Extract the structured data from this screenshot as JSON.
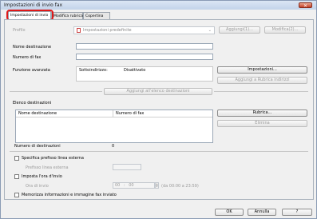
{
  "window": {
    "title": "Impostazioni di invio fax",
    "close_glyph": "✕"
  },
  "tabs": [
    {
      "label": "Impostazioni di invio"
    },
    {
      "label": "Modifica rubrica"
    },
    {
      "label": "Copertina"
    }
  ],
  "profile": {
    "label": "Profilo",
    "value": "Impostazioni predefinite",
    "add_button": "Aggiungi(1)...",
    "edit_button": "Modifica(2)..."
  },
  "destination_name": {
    "label": "Nome destinazione",
    "value": ""
  },
  "fax_number": {
    "label": "Numero di fax",
    "value": ""
  },
  "advanced": {
    "label": "Funzione avanzata",
    "subaddress_label": "Sottoindirizzo:",
    "subaddress_value": "Disattivato",
    "settings_button": "Impostazioni...",
    "add_to_book_button": "Aggiungi a Rubrica indirizzi"
  },
  "add_to_list_button": "Aggiungi all'elenco destinazioni",
  "destination_list": {
    "title": "Elenco destinazioni",
    "columns": [
      "Nome destinazione",
      "Numero di fax"
    ],
    "rows": [],
    "address_book_button": "Rubrica...",
    "delete_button": "Elimina"
  },
  "destination_count": {
    "label": "Numero di destinazioni",
    "value": "0"
  },
  "outside_prefix": {
    "checkbox_label": "Specifica prefisso linea esterna",
    "field_label": "Prefisso linea esterna",
    "value": "",
    "checked": false
  },
  "send_time": {
    "checkbox_label": "Imposta l'ora d'invio",
    "field_label": "Ora di invio",
    "hours": "00",
    "minutes": "00",
    "range": "(da 00:00 a 23:59)",
    "checked": false
  },
  "store_info": {
    "checkbox_label": "Memorizza informazioni e immagine fax inviato",
    "checked": false
  },
  "footer": {
    "ok": "OK",
    "cancel": "Annulla",
    "help": "?"
  },
  "colors": {
    "highlight": "#e01818",
    "title_bar": "#c3d3ea",
    "close_button": "#c5412a"
  }
}
